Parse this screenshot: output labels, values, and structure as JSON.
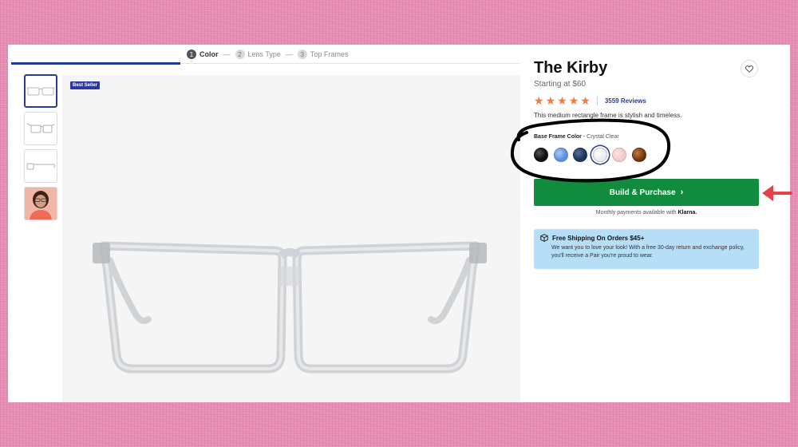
{
  "steps": [
    {
      "number": "1",
      "label": "Color",
      "active": true
    },
    {
      "number": "2",
      "label": "Lens Type",
      "active": false
    },
    {
      "number": "3",
      "label": "Top Frames",
      "active": false
    }
  ],
  "step_separator": "—",
  "badge": "Best Seller",
  "product": {
    "title": "The Kirby",
    "price": "Starting at $60",
    "rating_stars": 5,
    "reviews": "3559 Reviews",
    "description": "This medium rectangle frame is stylish and timeless."
  },
  "color": {
    "label": "Base Frame Color",
    "separator": "-",
    "selected": "Crystal Clear",
    "swatches": [
      {
        "name": "black",
        "color": "#111111"
      },
      {
        "name": "blue",
        "color": "#5a8fe0"
      },
      {
        "name": "navy",
        "color": "#1e3358"
      },
      {
        "name": "crystal-clear",
        "color": "#e9ecf2",
        "selected": true
      },
      {
        "name": "pink",
        "color": "#f3c9cc"
      },
      {
        "name": "tortoise",
        "color": "#7a3d14"
      }
    ]
  },
  "actions": {
    "build_label": "Build & Purchase",
    "monthly_prefix": "Monthly payments available with",
    "monthly_brand": "Klarna."
  },
  "shipping": {
    "title": "Free Shipping On Orders $45+",
    "text": "We want you to love your look! With a free 30-day return and exchange policy, you'll receive a Pair you're proud to wear."
  },
  "colors": {
    "accent": "#1f3c91",
    "build_button": "#118c3f",
    "star": "#f07b3a",
    "shipping_bg": "#b6def7",
    "annotation_arrow": "#e2434a",
    "background": "#e68bb3"
  }
}
